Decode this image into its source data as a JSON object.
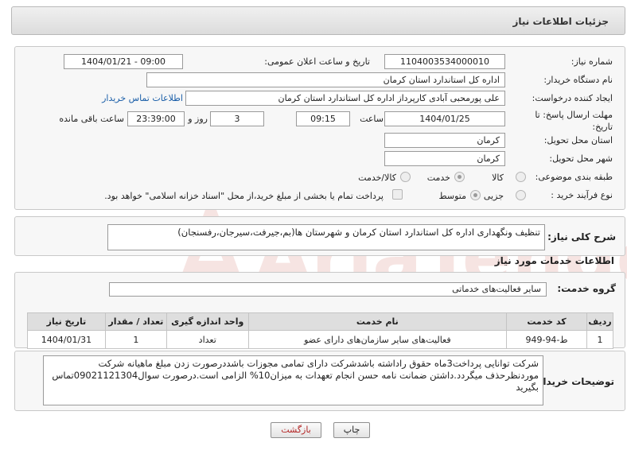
{
  "header": {
    "title": "جزئیات اطلاعات نیاز"
  },
  "form": {
    "need_number_label": "شماره نیاز:",
    "need_number": "1104003534000010",
    "announce_label": "تاریخ و ساعت اعلان عمومی:",
    "announce_value": "1404/01/21 - 09:00",
    "buyer_label": "نام دستگاه خریدار:",
    "buyer_value": "اداره کل استاندارد استان کرمان",
    "creator_label": "ایجاد کننده درخواست:",
    "creator_value": "علی پورمحبی آبادی کارپرداز اداره کل استاندارد استان کرمان",
    "contact_link": "اطلاعات تماس خریدار",
    "deadline_label": "مهلت ارسال پاسخ: تا تاریخ:",
    "deadline_date": "1404/01/25",
    "time_label": "ساعت",
    "deadline_time": "09:15",
    "days_value": "3",
    "days_label": "روز و",
    "remaining_time": "23:39:00",
    "remaining_label": "ساعت باقی مانده",
    "province_label": "استان محل تحویل:",
    "province_value": "کرمان",
    "city_label": "شهر محل تحویل:",
    "city_value": "کرمان",
    "category_label": "طبقه بندی موضوعی:",
    "category_options": [
      "کالا",
      "خدمت",
      "کالا/خدمت"
    ],
    "category_selected": "خدمت",
    "process_label": "نوع فرآیند خرید :",
    "process_options": [
      "جزیی",
      "متوسط"
    ],
    "process_selected": "متوسط",
    "treasury_note": "پرداخت تمام یا بخشی از مبلغ خرید،از محل \"اسناد خزانه اسلامی\" خواهد بود."
  },
  "need_desc": {
    "label": "شرح کلی نیاز:",
    "value": "تنظیف ونگهداری اداره کل استاندارد استان کرمان و شهرستان ها(بم،جیرفت،سیرجان،رفسنجان)"
  },
  "services": {
    "section_title": "اطلاعات خدمات مورد نیاز",
    "group_label": "گروه خدمت:",
    "group_value": "سایر فعالیت‌های خدماتی",
    "columns": [
      "ردیف",
      "کد خدمت",
      "نام خدمت",
      "واحد اندازه گیری",
      "تعداد / مقدار",
      "تاریخ نیاز"
    ],
    "rows": [
      [
        "1",
        "ط-94-949",
        "فعالیت‌های سایر سازمان‌های دارای عضو",
        "تعداد",
        "1",
        "1404/01/31"
      ]
    ]
  },
  "buyer_notes": {
    "label": "توضیحات خریدار:",
    "value": "شرکت توانایی پرداخت3ماه حقوق راداشته باشدشرکت دارای تمامی مجوزات باشددرصورت زدن مبلغ ماهیانه شرکت موردنظرحذف میگردد.داشتن ضمانت نامه حسن انجام تعهدات به میزان10% الزامی است.درصورت سوال09021121304تماس بگیرید"
  },
  "buttons": {
    "print": "چاپ",
    "back": "بازگشت"
  },
  "watermark": {
    "text": "AriaTender.neT"
  },
  "colors": {
    "link": "#1a5ea8",
    "back_text": "#b22222",
    "watermark": "#c0392b"
  }
}
